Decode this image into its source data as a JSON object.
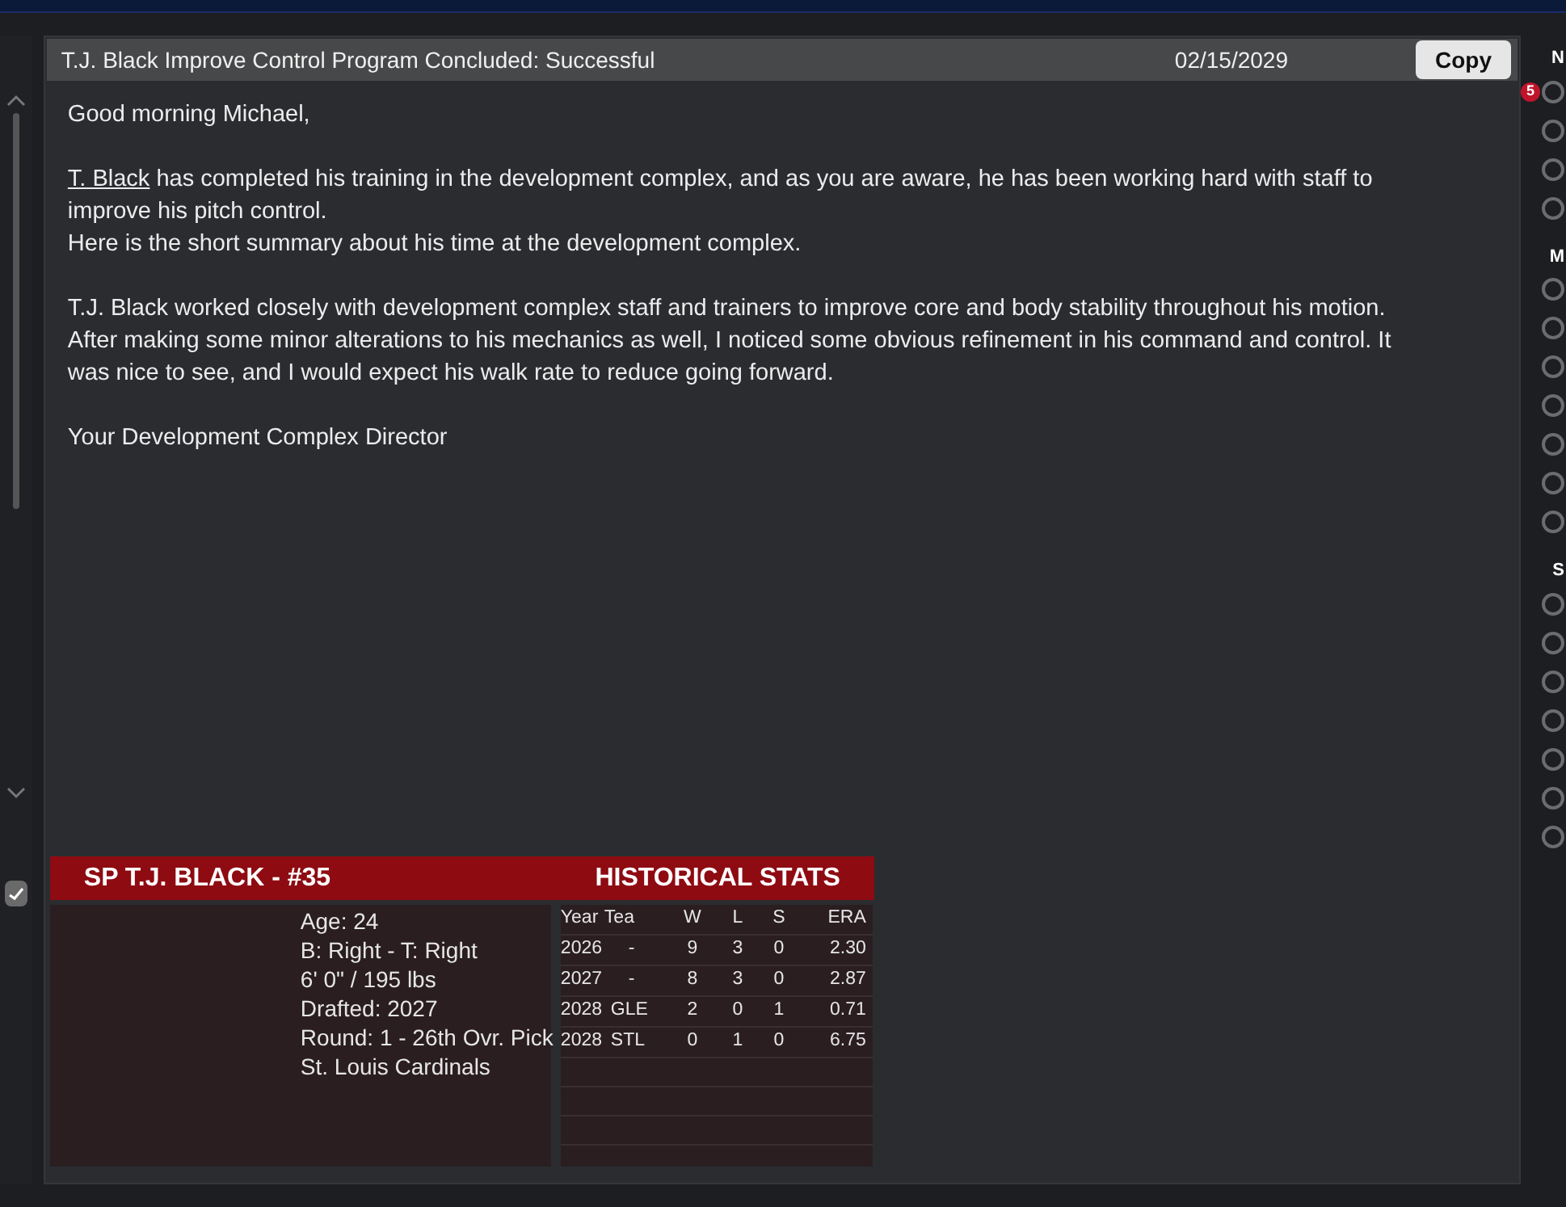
{
  "message": {
    "title": "T.J. Black Improve Control Program Concluded: Successful",
    "date": "02/15/2029",
    "copy_button": "Copy",
    "greeting": "Good morning Michael,",
    "blocks": [
      [
        {
          "link": "T. Black",
          "text": " has completed his training in the development complex, and as you are aware, he has been working hard with staff to improve his pitch control."
        },
        {
          "text": "Here is the short summary about his time at the development complex."
        }
      ],
      [
        {
          "text": "T.J. Black worked closely with development complex staff and trainers to improve core and body stability throughout his motion. After making some minor alterations to his mechanics as well, I noticed some obvious refinement in his command and control. It was nice to see, and I would expect his walk rate to reduce going forward."
        }
      ],
      [
        {
          "text": "Your Development Complex Director"
        }
      ]
    ]
  },
  "player_card": {
    "title": "SP T.J. BLACK - #35",
    "stats_title": "HISTORICAL STATS",
    "info": [
      "Age: 24",
      "B: Right - T: Right",
      "6' 0\"  / 195 lbs",
      "Drafted: 2027",
      "Round: 1 - 26th Ovr. Pick",
      "St. Louis Cardinals"
    ],
    "columns": [
      "Year",
      "Tea",
      "W",
      "L",
      "S",
      "ERA"
    ],
    "rows": [
      [
        "2026",
        "-",
        "9",
        "3",
        "0",
        "2.30"
      ],
      [
        "2027",
        "-",
        "8",
        "3",
        "0",
        "2.87"
      ],
      [
        "2028",
        "GLE",
        "2",
        "0",
        "1",
        "0.71"
      ],
      [
        "2028",
        "STL",
        "0",
        "1",
        "0",
        "6.75"
      ]
    ]
  },
  "left_panel": {
    "checkbox": {
      "checked": true
    }
  },
  "right_sidebar": {
    "sections": [
      {
        "label": "N",
        "badge": "5"
      },
      {
        "label": "M"
      },
      {
        "label": "S"
      }
    ]
  }
}
